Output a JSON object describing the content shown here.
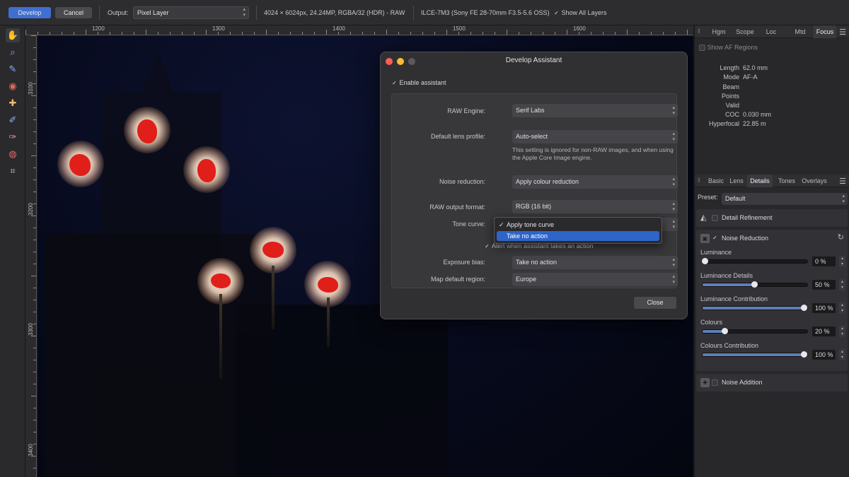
{
  "toolbar": {
    "develop_label": "Develop",
    "cancel_label": "Cancel",
    "output_label": "Output:",
    "output_value": "Pixel Layer",
    "image_info": "4024 × 6024px, 24.24MP, RGBA/32 (HDR) - RAW",
    "camera_info": "ILCE-7M3 (Sony FE 28-70mm F3.5-5.6 OSS)",
    "show_all_layers": "Show All Layers"
  },
  "ruler": {
    "unit": "px",
    "h_labels": [
      "1200",
      "1300",
      "1400",
      "1500",
      "1600"
    ],
    "v_labels": [
      "3100",
      "3200",
      "3300",
      "3400"
    ]
  },
  "dialog": {
    "title": "Develop Assistant",
    "enable_label": "Enable assistant",
    "raw_engine_label": "RAW Engine:",
    "raw_engine_value": "Serif Labs",
    "lens_label": "Default lens profile:",
    "lens_value": "Auto-select",
    "lens_note": "This setting is ignored for non-RAW images, and when using the Apple Core Image engine.",
    "noise_label": "Noise reduction:",
    "noise_value": "Apply colour reduction",
    "raw_format_label": "RAW output format:",
    "raw_format_value": "RGB (16 bit)",
    "tone_curve_label": "Tone curve:",
    "alert_label": "Alert when assistant takes an action",
    "exposure_label": "Exposure bias:",
    "exposure_value": "Take no action",
    "map_label": "Map default region:",
    "map_value": "Europe",
    "close_label": "Close",
    "popup": {
      "items": [
        "Apply tone curve",
        "Take no action"
      ],
      "checked_index": 0,
      "highlighted_index": 1
    }
  },
  "top_panel": {
    "tabs": [
      "Hgm",
      "Scope",
      "Loc",
      "Mtd",
      "Focus"
    ],
    "active_tab": "Focus",
    "show_af_regions": "Show AF Regions",
    "rows": [
      {
        "key": "Length",
        "value": "62.0 mm"
      },
      {
        "key": "Mode",
        "value": "AF-A"
      },
      {
        "key": "Beam",
        "value": ""
      },
      {
        "key": "Points",
        "value": ""
      },
      {
        "key": "Valid",
        "value": ""
      },
      {
        "key": "COC",
        "value": "0.030 mm"
      },
      {
        "key": "Hyperfocal",
        "value": "22.85 m"
      }
    ]
  },
  "bottom_panel": {
    "tabs": [
      "Basic",
      "Lens",
      "Details",
      "Tones",
      "Overlays"
    ],
    "active_tab": "Details",
    "preset_label": "Preset:",
    "preset_value": "Default",
    "detail_refinement": "Detail Refinement",
    "noise_reduction": "Noise Reduction",
    "noise_addition": "Noise Addition",
    "sliders": [
      {
        "label": "Luminance",
        "value_text": "0 %",
        "fraction": 0.0
      },
      {
        "label": "Luminance Details",
        "value_text": "50 %",
        "fraction": 0.5
      },
      {
        "label": "Luminance Contribution",
        "value_text": "100 %",
        "fraction": 1.0
      },
      {
        "label": "Colours",
        "value_text": "20 %",
        "fraction": 0.2
      },
      {
        "label": "Colours Contribution",
        "value_text": "100 %",
        "fraction": 1.0
      }
    ]
  },
  "colors": {
    "accent": "#3f6fd1",
    "highlight": "#2f64c8",
    "clip_warning": "#e01f1a"
  }
}
